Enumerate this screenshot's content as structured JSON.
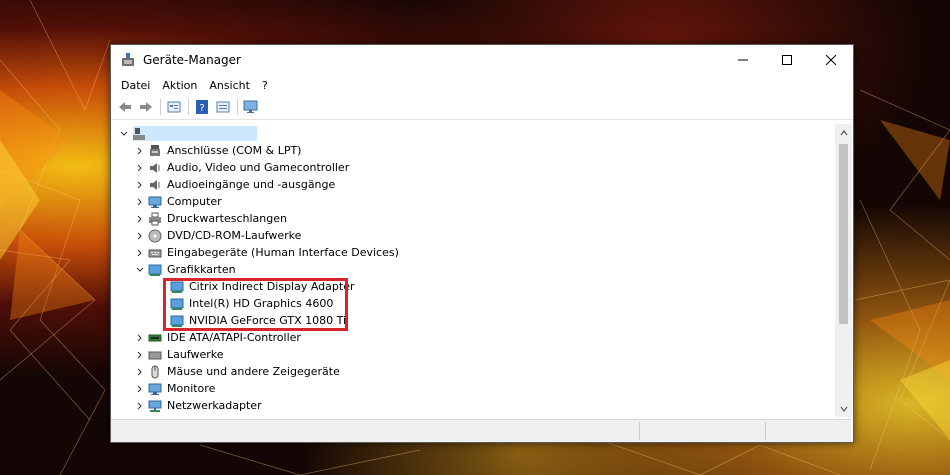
{
  "window": {
    "title": "Geräte-Manager",
    "controls": {
      "minimize": "minimize",
      "maximize": "maximize",
      "close": "close"
    }
  },
  "menu": [
    "Datei",
    "Aktion",
    "Ansicht",
    "?"
  ],
  "toolbar": {
    "buttons": [
      "back-icon",
      "forward-icon",
      "properties-icon",
      "help-icon",
      "update-driver-icon",
      "monitor-scan-icon"
    ]
  },
  "tree": {
    "root_label": "",
    "categories": [
      {
        "label": "Anschlüsse (COM & LPT)",
        "icon": "port-icon",
        "expanded": false
      },
      {
        "label": "Audio, Video und Gamecontroller",
        "icon": "speaker-icon",
        "expanded": false
      },
      {
        "label": "Audioeingänge und -ausgänge",
        "icon": "speaker-icon",
        "expanded": false
      },
      {
        "label": "Computer",
        "icon": "computer-icon",
        "expanded": false
      },
      {
        "label": "Druckwarteschlangen",
        "icon": "printer-icon",
        "expanded": false
      },
      {
        "label": "DVD/CD-ROM-Laufwerke",
        "icon": "disc-drive-icon",
        "expanded": false
      },
      {
        "label": "Eingabegeräte (Human Interface Devices)",
        "icon": "hid-icon",
        "expanded": false
      },
      {
        "label": "Grafikkarten",
        "icon": "display-adapter-icon",
        "expanded": true,
        "children": [
          "Citrix Indirect Display Adapter",
          "Intel(R) HD Graphics 4600",
          "NVIDIA GeForce GTX 1080 Ti"
        ]
      },
      {
        "label": "IDE ATA/ATAPI-Controller",
        "icon": "ide-controller-icon",
        "expanded": false
      },
      {
        "label": "Laufwerke",
        "icon": "drive-icon",
        "expanded": false
      },
      {
        "label": "Mäuse und andere Zeigegeräte",
        "icon": "mouse-icon",
        "expanded": false
      },
      {
        "label": "Monitore",
        "icon": "monitor-icon",
        "expanded": false
      },
      {
        "label": "Netzwerkadapter",
        "icon": "network-adapter-icon",
        "expanded": false
      }
    ]
  },
  "colors": {
    "selection": "#cce8ff",
    "highlight_border": "#d7262a"
  }
}
